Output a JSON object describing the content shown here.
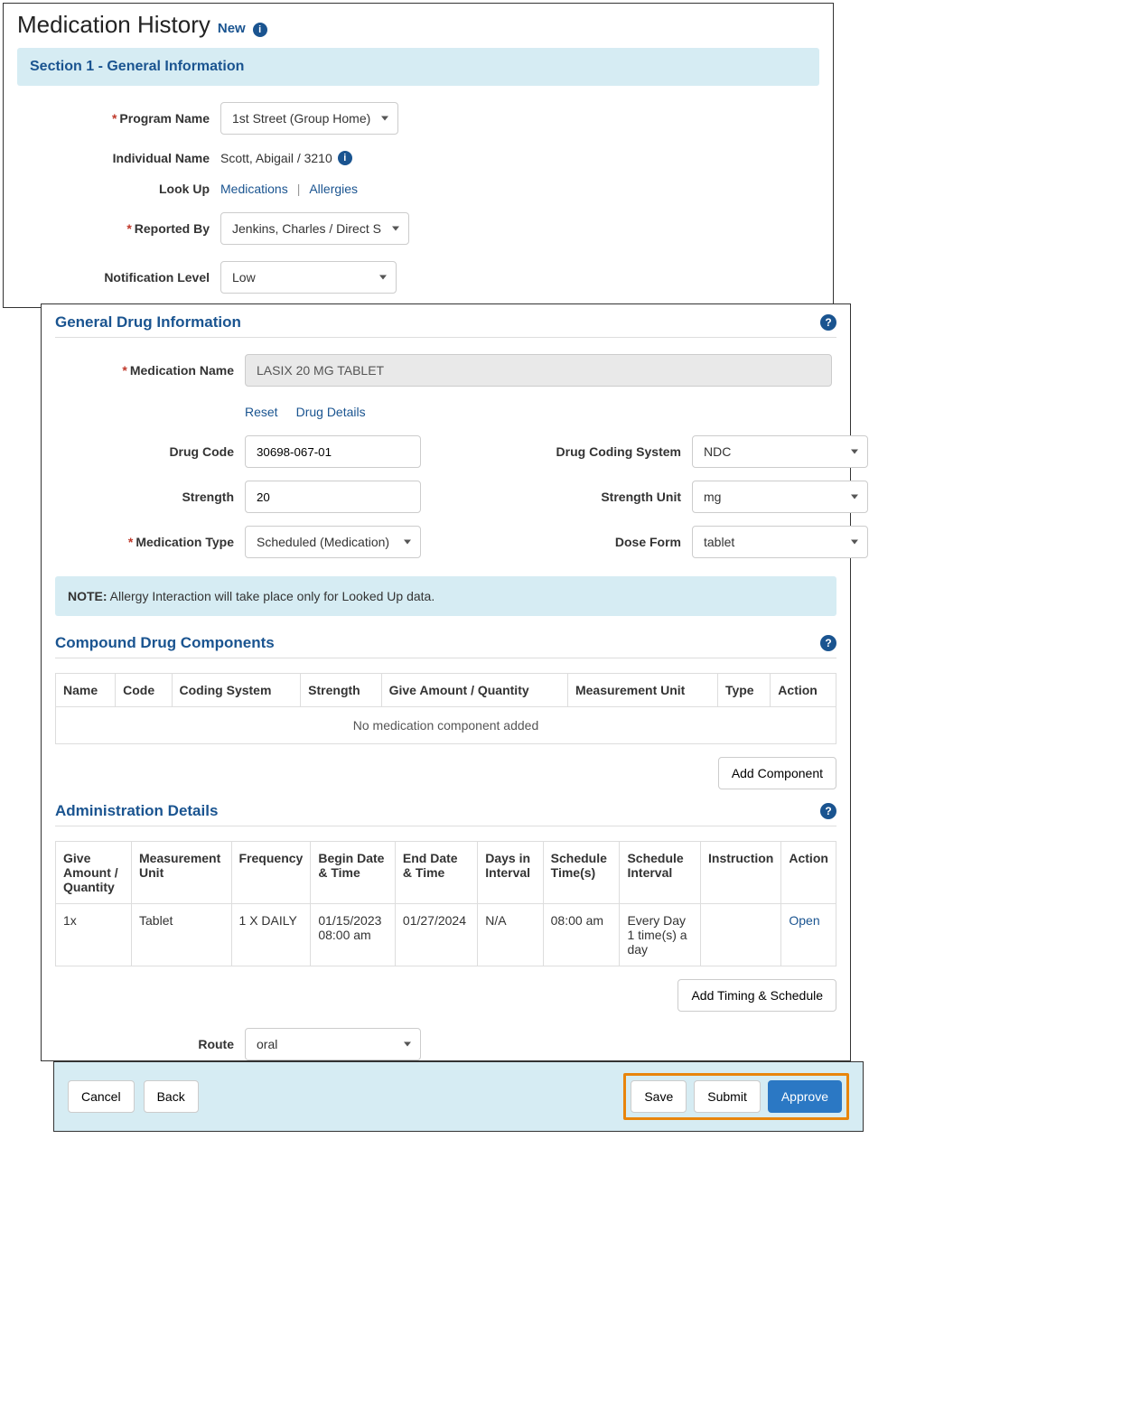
{
  "header": {
    "title": "Medication History",
    "new_label": "New"
  },
  "section1": {
    "title": "Section 1 - General Information",
    "program_name_label": "Program Name",
    "program_name_value": "1st Street (Group Home)",
    "individual_name_label": "Individual Name",
    "individual_name_value": "Scott, Abigail / 3210",
    "lookup_label": "Look Up",
    "lookup_medications": "Medications",
    "lookup_allergies": "Allergies",
    "reported_by_label": "Reported By",
    "reported_by_value": "Jenkins, Charles / Direct S",
    "notification_level_label": "Notification Level",
    "notification_level_value": "Low"
  },
  "drug_info": {
    "title": "General Drug Information",
    "medication_name_label": "Medication Name",
    "medication_name_value": "LASIX 20 MG TABLET",
    "reset_label": "Reset",
    "drug_details_label": "Drug Details",
    "drug_code_label": "Drug Code",
    "drug_code_value": "30698-067-01",
    "drug_coding_system_label": "Drug Coding System",
    "drug_coding_system_value": "NDC",
    "strength_label": "Strength",
    "strength_value": "20",
    "strength_unit_label": "Strength Unit",
    "strength_unit_value": "mg",
    "medication_type_label": "Medication Type",
    "medication_type_value": "Scheduled (Medication)",
    "dose_form_label": "Dose Form",
    "dose_form_value": "tablet",
    "note_label": "NOTE:",
    "note_text": " Allergy Interaction will take place only for Looked Up data."
  },
  "compound": {
    "title": "Compound Drug Components",
    "headers": {
      "name": "Name",
      "code": "Code",
      "coding_system": "Coding System",
      "strength": "Strength",
      "give_amount": "Give Amount / Quantity",
      "measurement_unit": "Measurement Unit",
      "type": "Type",
      "action": "Action"
    },
    "empty_text": "No medication component added",
    "add_button": "Add Component"
  },
  "admin": {
    "title": "Administration Details",
    "headers": {
      "give_amount": "Give Amount / Quantity",
      "measurement_unit": "Measurement Unit",
      "frequency": "Frequency",
      "begin": "Begin Date & Time",
      "end": "End Date & Time",
      "days": "Days in Interval",
      "schedule_times": "Schedule Time(s)",
      "schedule_interval": "Schedule Interval",
      "instruction": "Instruction",
      "action": "Action"
    },
    "row": {
      "give_amount": "1x",
      "measurement_unit": "Tablet",
      "frequency": "1 X DAILY",
      "begin": "01/15/2023 08:00 am",
      "end": "01/27/2024",
      "days": "N/A",
      "schedule_times": "08:00 am",
      "schedule_interval": "Every Day 1 time(s) a day",
      "instruction": "",
      "action": "Open"
    },
    "add_button": "Add Timing & Schedule",
    "route_label": "Route",
    "route_value": "oral"
  },
  "footer": {
    "cancel": "Cancel",
    "back": "Back",
    "save": "Save",
    "submit": "Submit",
    "approve": "Approve"
  }
}
